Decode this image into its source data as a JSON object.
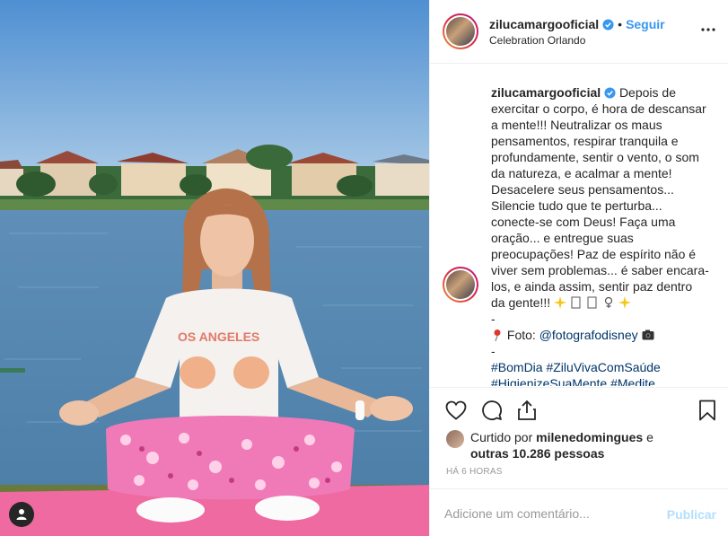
{
  "post": {
    "username": "zilucamargooficial",
    "location": "Celebration Orlando",
    "follow_label": "Seguir",
    "dot": "•"
  },
  "caption": {
    "username": "zilucamargooficial",
    "line1": "Depois de",
    "line2": "exercitar o corpo, é hora de descansar",
    "line3": "a mente!!! Neutralizar os maus",
    "line4": "pensamentos, respirar tranquila e",
    "line5": "profundamente, sentir o vento, o som",
    "line6": "da natureza, e acalmar a mente!",
    "line7": "Desacelere seus pensamentos...",
    "line8": "Silencie tudo que te perturba...",
    "line9": "conecte-se com Deus! Faça uma",
    "line10": "oração... e entregue suas",
    "line11": "preocupações! Paz de espírito não é",
    "line12": "viver sem problemas... é saber encara-",
    "line13": "los, e ainda assim, sentir paz dentro",
    "line14": "da gente!!!",
    "dash1": "-",
    "photo_label": "Foto:",
    "photo_credit": "@fotografodisney",
    "dash2": "-",
    "hashtags1": "#BomDia #ZiluVivaComSaúde",
    "hashtags2": "#HigienizeSuaMente #Medite"
  },
  "likes": {
    "prefix": "Curtido por",
    "user": "milenedomingues",
    "mid": "e",
    "others": "outras 10.286 pessoas"
  },
  "time_ago": "HÁ 6 HORAS",
  "comment": {
    "placeholder": "Adicione um comentário...",
    "publish_label": "Publicar"
  },
  "colors": {
    "link": "#3897f0",
    "verified": "#3897f0",
    "publish_disabled": "#b2dffc"
  }
}
